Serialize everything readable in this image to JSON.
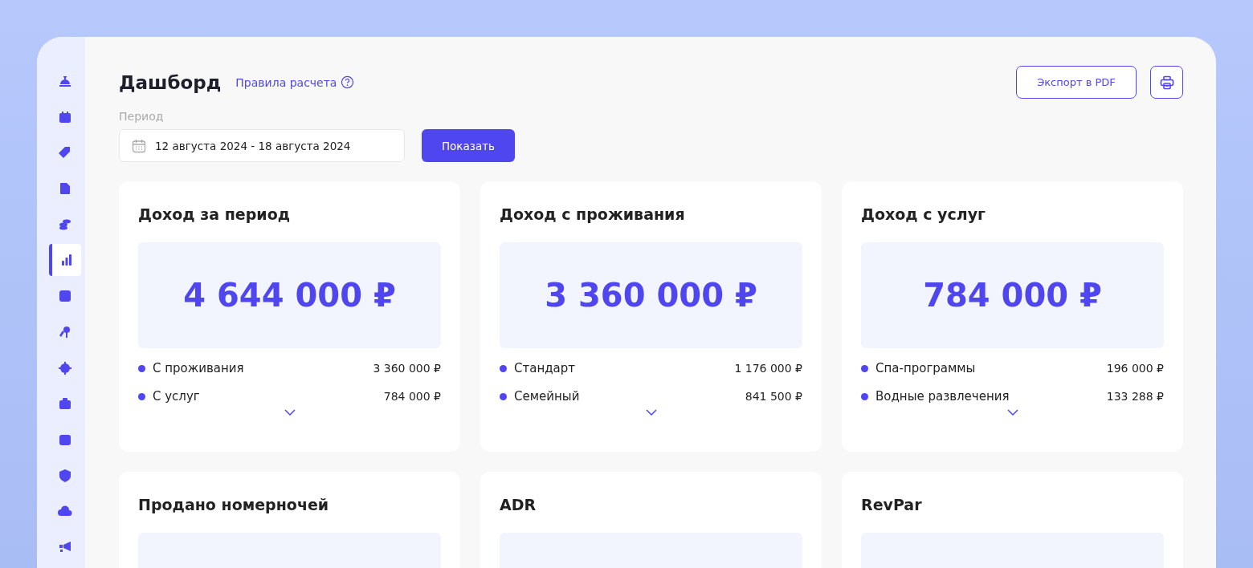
{
  "sidebar": {
    "items": [
      {
        "selected": false
      },
      {
        "selected": false
      },
      {
        "selected": false
      },
      {
        "selected": false
      },
      {
        "selected": false
      },
      {
        "selected": true
      },
      {
        "selected": false
      },
      {
        "selected": false
      },
      {
        "selected": false
      },
      {
        "selected": false
      },
      {
        "selected": false
      },
      {
        "selected": false
      },
      {
        "selected": false
      },
      {
        "selected": false
      }
    ]
  },
  "header": {
    "title": "Дашборд",
    "rules_link": "Правила расчета",
    "export_button": "Экспорт в PDF"
  },
  "period": {
    "label": "Период",
    "value": "12 августа 2024 - 18 августа 2024",
    "show_button": "Показать"
  },
  "cards": [
    {
      "title": "Доход за период",
      "amount": "4 644 000 ₽",
      "expanded": false,
      "rows": [
        {
          "label": "С проживания",
          "value": "3 360 000 ₽"
        },
        {
          "label": "С услуг",
          "value": "784 000 ₽"
        }
      ]
    },
    {
      "title": "Доход с проживания",
      "amount": "3 360 000 ₽",
      "expanded": false,
      "rows": [
        {
          "label": "Стандарт",
          "value": "1 176 000 ₽"
        },
        {
          "label": "Семейный",
          "value": "841 500 ₽"
        }
      ]
    },
    {
      "title": "Доход с услуг",
      "amount": "784 000 ₽",
      "expanded": false,
      "rows": [
        {
          "label": "Спа-программы",
          "value": "196 000 ₽"
        },
        {
          "label": "Водные развлечения",
          "value": "133 288 ₽"
        }
      ]
    },
    {
      "title": "Продано номерночей"
    },
    {
      "title": "ADR"
    },
    {
      "title": "RevPar"
    }
  ]
}
